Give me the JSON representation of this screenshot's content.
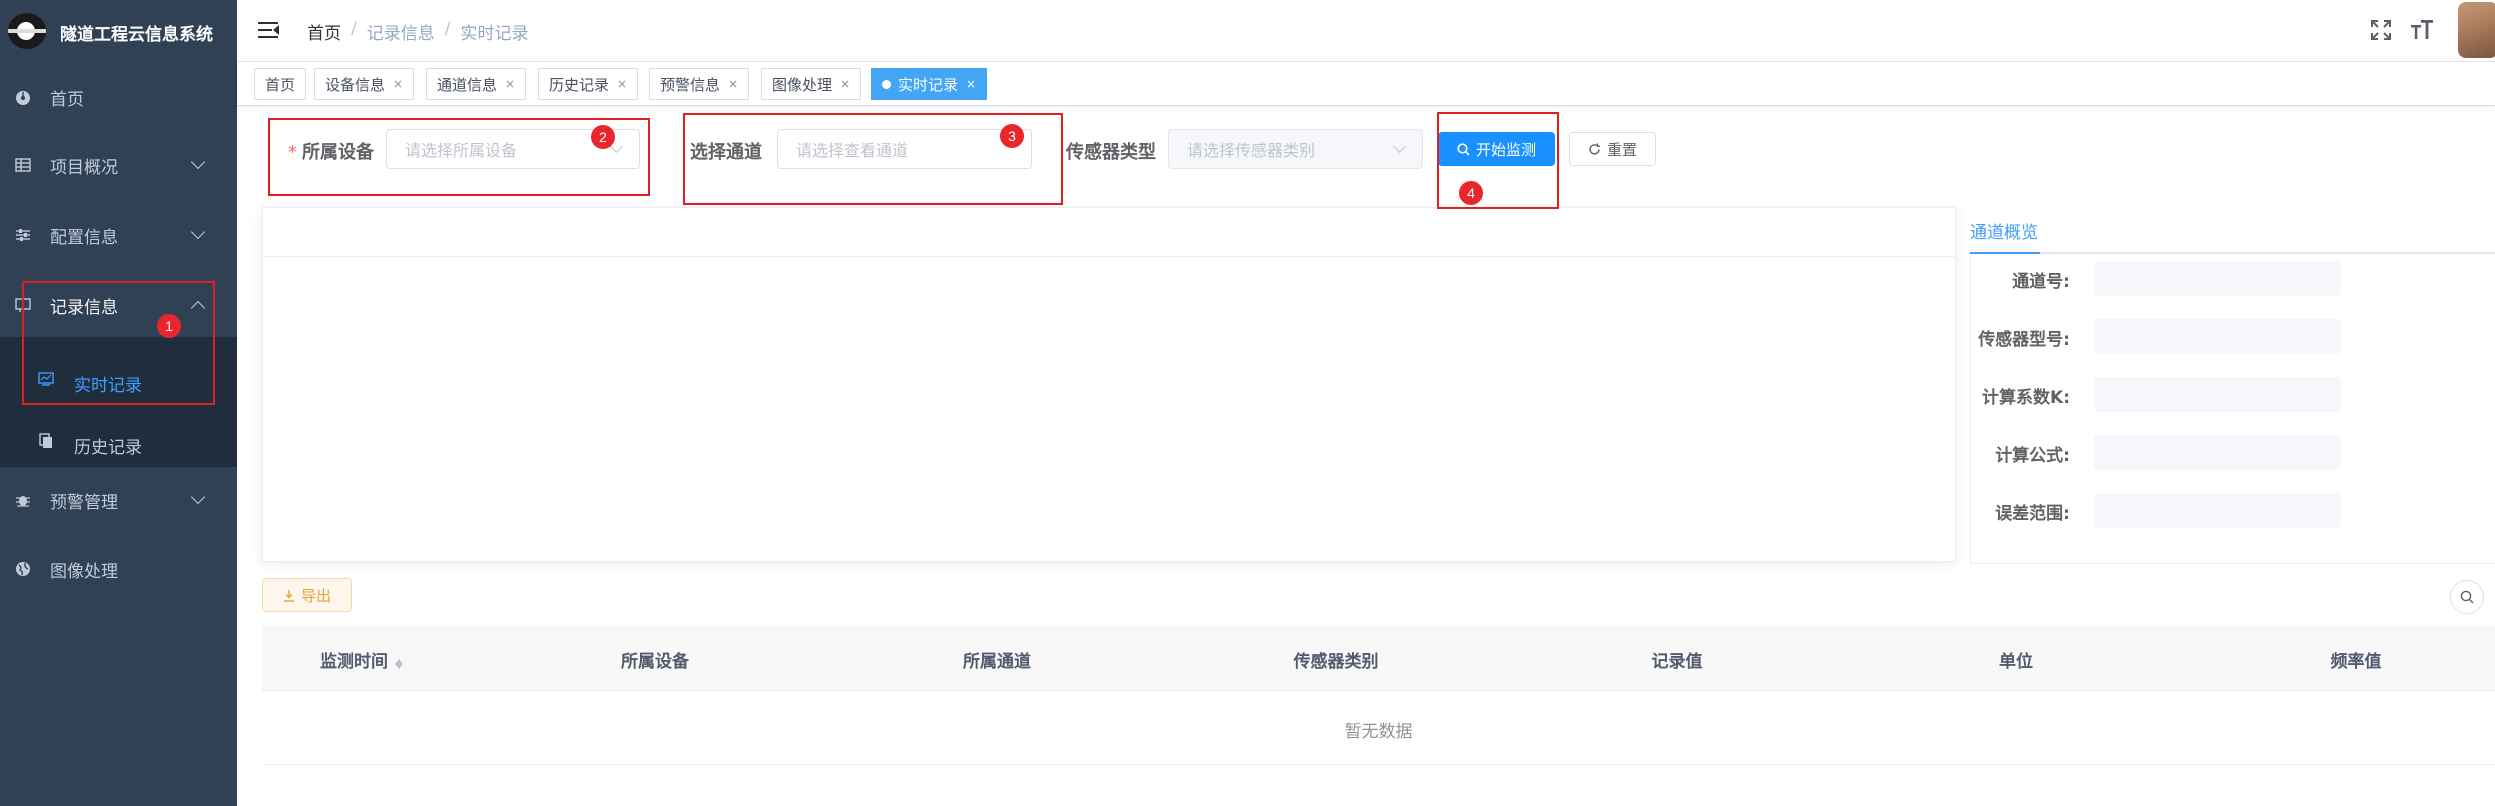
{
  "app": {
    "title": "隧道工程云信息系统"
  },
  "sidebar": {
    "items": [
      {
        "label": "首页",
        "icon": "dashboard-icon"
      },
      {
        "label": "项目概况",
        "icon": "table-icon"
      },
      {
        "label": "配置信息",
        "icon": "sliders-icon"
      },
      {
        "label": "记录信息",
        "icon": "record-icon"
      },
      {
        "label": "预警管理",
        "icon": "bug-icon"
      },
      {
        "label": "图像处理",
        "icon": "globe-icon"
      }
    ],
    "subitems": [
      {
        "label": "实时记录",
        "icon": "monitor-icon"
      },
      {
        "label": "历史记录",
        "icon": "documents-icon"
      }
    ]
  },
  "header": {
    "breadcrumb": [
      "首页",
      "记录信息",
      "实时记录"
    ],
    "separator": "/"
  },
  "tags": [
    {
      "label": "首页"
    },
    {
      "label": "设备信息"
    },
    {
      "label": "通道信息"
    },
    {
      "label": "历史记录"
    },
    {
      "label": "预警信息"
    },
    {
      "label": "图像处理"
    },
    {
      "label": "实时记录"
    }
  ],
  "tag_close": "×",
  "form": {
    "device": {
      "label": "所属设备",
      "required_mark": "*",
      "placeholder": "请选择所属设备"
    },
    "channel": {
      "label": "选择通道",
      "placeholder": "请选择查看通道"
    },
    "sensor": {
      "label": "传感器类型",
      "placeholder": "请选择传感器类别"
    },
    "start_button": "开始监测",
    "reset_button": "重置"
  },
  "annotations": [
    "1",
    "2",
    "3",
    "4"
  ],
  "panel": {
    "tab": "通道概览",
    "fields": [
      {
        "label": "通道号:"
      },
      {
        "label": "传感器型号:"
      },
      {
        "label": "计算系数K:"
      },
      {
        "label": "计算公式:"
      },
      {
        "label": "误差范围:"
      }
    ]
  },
  "toolbar": {
    "export_button": "导出"
  },
  "table": {
    "columns": [
      "监测时间",
      "所属设备",
      "所属通道",
      "传感器类别",
      "记录值",
      "单位",
      "频率值"
    ],
    "empty_text": "暂无数据"
  },
  "colors": {
    "sidebar_bg": "#304156",
    "primary": "#1890ff",
    "annotation": "#e02020"
  }
}
